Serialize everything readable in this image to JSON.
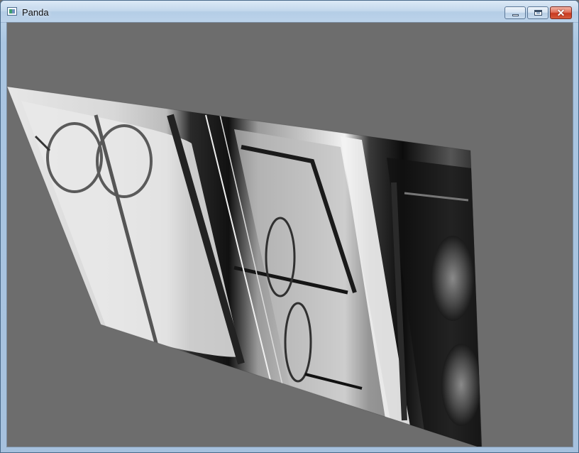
{
  "window": {
    "title": "Panda",
    "controls": {
      "minimize_icon": "minimize-icon",
      "maximize_icon": "maximize-icon",
      "close_icon": "close-icon",
      "close_glyph": "✕"
    }
  },
  "viewport": {
    "background_color": "#6d6d6d",
    "content": "textured-quad",
    "texture": "grayscale-photo"
  },
  "colors": {
    "titlebar": "#c3d7ec",
    "close_button": "#c8391f"
  }
}
